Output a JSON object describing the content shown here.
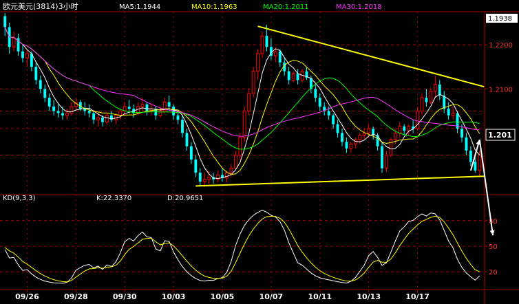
{
  "chart_data": {
    "type": "candlestick",
    "title": "欧元美元(3814)3小时",
    "ma_labels": [
      {
        "text": "MA5:1.1944",
        "color": "#ffffff"
      },
      {
        "text": "MA10:1.1963",
        "color": "#ffff00"
      },
      {
        "text": "MA20:1.2011",
        "color": "#00ff00"
      },
      {
        "text": "MA30:1.2018",
        "color": "#ff33ff"
      }
    ],
    "price_ylim": [
      1.1865,
      1.2275
    ],
    "price_ticks": [
      {
        "value": 1.22,
        "label": "1.2200"
      },
      {
        "value": 1.21,
        "label": "1.2100"
      }
    ],
    "top_price_label": "1.1938",
    "current_price_label": "1.201",
    "current_price": 1.201,
    "candles": [
      [
        1.2265,
        1.2272,
        1.222,
        1.224
      ],
      [
        1.224,
        1.225,
        1.218,
        1.2195
      ],
      [
        1.2195,
        1.223,
        1.2185,
        1.2215
      ],
      [
        1.2215,
        1.2225,
        1.2175,
        1.2185
      ],
      [
        1.2185,
        1.22,
        1.216,
        1.217
      ],
      [
        1.217,
        1.219,
        1.215,
        1.218
      ],
      [
        1.218,
        1.2185,
        1.214,
        1.215
      ],
      [
        1.215,
        1.216,
        1.211,
        1.212
      ],
      [
        1.212,
        1.213,
        1.209,
        1.21
      ],
      [
        1.21,
        1.211,
        1.207,
        1.208
      ],
      [
        1.208,
        1.209,
        1.205,
        1.206
      ],
      [
        1.206,
        1.2075,
        1.204,
        1.205
      ],
      [
        1.205,
        1.2065,
        1.2035,
        1.2045
      ],
      [
        1.2045,
        1.206,
        1.203,
        1.204
      ],
      [
        1.204,
        1.2055,
        1.203,
        1.2045
      ],
      [
        1.2045,
        1.207,
        1.204,
        1.206
      ],
      [
        1.206,
        1.208,
        1.205,
        1.207
      ],
      [
        1.207,
        1.2075,
        1.205,
        1.2055
      ],
      [
        1.2055,
        1.207,
        1.204,
        1.205
      ],
      [
        1.205,
        1.2065,
        1.2035,
        1.2045
      ],
      [
        1.2045,
        1.205,
        1.202,
        1.203
      ],
      [
        1.203,
        1.2045,
        1.2015,
        1.2035
      ],
      [
        1.2035,
        1.204,
        1.2015,
        1.2025
      ],
      [
        1.2025,
        1.2045,
        1.202,
        1.204
      ],
      [
        1.204,
        1.205,
        1.2025,
        1.203
      ],
      [
        1.203,
        1.2045,
        1.202,
        1.204
      ],
      [
        1.204,
        1.2055,
        1.203,
        1.205
      ],
      [
        1.205,
        1.207,
        1.204,
        1.206
      ],
      [
        1.206,
        1.2075,
        1.2045,
        1.2055
      ],
      [
        1.2055,
        1.2065,
        1.2035,
        1.2045
      ],
      [
        1.2045,
        1.207,
        1.204,
        1.206
      ],
      [
        1.206,
        1.208,
        1.205,
        1.2065
      ],
      [
        1.2065,
        1.207,
        1.204,
        1.205
      ],
      [
        1.205,
        1.2065,
        1.204,
        1.2055
      ],
      [
        1.2055,
        1.206,
        1.203,
        1.204
      ],
      [
        1.204,
        1.206,
        1.2035,
        1.205
      ],
      [
        1.205,
        1.208,
        1.2045,
        1.207
      ],
      [
        1.207,
        1.2085,
        1.205,
        1.206
      ],
      [
        1.206,
        1.2065,
        1.203,
        1.204
      ],
      [
        1.204,
        1.205,
        1.202,
        1.203
      ],
      [
        1.203,
        1.204,
        1.199,
        1.2
      ],
      [
        1.2,
        1.201,
        1.196,
        1.197
      ],
      [
        1.197,
        1.198,
        1.193,
        1.194
      ],
      [
        1.194,
        1.195,
        1.19,
        1.191
      ],
      [
        1.191,
        1.192,
        1.188,
        1.189
      ],
      [
        1.189,
        1.191,
        1.1878,
        1.1895
      ],
      [
        1.1895,
        1.1915,
        1.1885,
        1.19
      ],
      [
        1.19,
        1.191,
        1.1885,
        1.1895
      ],
      [
        1.1895,
        1.1915,
        1.1888,
        1.1905
      ],
      [
        1.1905,
        1.192,
        1.189,
        1.1898
      ],
      [
        1.1898,
        1.1915,
        1.1888,
        1.191
      ],
      [
        1.191,
        1.193,
        1.19,
        1.192
      ],
      [
        1.192,
        1.196,
        1.1915,
        1.195
      ],
      [
        1.195,
        1.2,
        1.194,
        1.199
      ],
      [
        1.199,
        1.206,
        1.198,
        1.205
      ],
      [
        1.205,
        1.21,
        1.204,
        1.209
      ],
      [
        1.209,
        1.215,
        1.208,
        1.214
      ],
      [
        1.214,
        1.219,
        1.212,
        1.218
      ],
      [
        1.218,
        1.223,
        1.217,
        1.222
      ],
      [
        1.222,
        1.2245,
        1.2185,
        1.2195
      ],
      [
        1.2195,
        1.2215,
        1.2165,
        1.2175
      ],
      [
        1.2175,
        1.2195,
        1.216,
        1.2185
      ],
      [
        1.2185,
        1.219,
        1.215,
        1.216
      ],
      [
        1.216,
        1.217,
        1.213,
        1.214
      ],
      [
        1.214,
        1.215,
        1.211,
        1.212
      ],
      [
        1.212,
        1.214,
        1.2115,
        1.2135
      ],
      [
        1.2135,
        1.2145,
        1.211,
        1.212
      ],
      [
        1.212,
        1.2145,
        1.2115,
        1.214
      ],
      [
        1.214,
        1.215,
        1.212,
        1.2125
      ],
      [
        1.2125,
        1.213,
        1.209,
        1.21
      ],
      [
        1.21,
        1.211,
        1.207,
        1.208
      ],
      [
        1.208,
        1.209,
        1.205,
        1.206
      ],
      [
        1.206,
        1.207,
        1.204,
        1.205
      ],
      [
        1.205,
        1.206,
        1.203,
        1.204
      ],
      [
        1.204,
        1.2045,
        1.201,
        1.202
      ],
      [
        1.202,
        1.203,
        1.199,
        1.2
      ],
      [
        1.2,
        1.201,
        1.197,
        1.198
      ],
      [
        1.198,
        1.199,
        1.1955,
        1.1965
      ],
      [
        1.1965,
        1.198,
        1.1955,
        1.1975
      ],
      [
        1.1975,
        1.199,
        1.1965,
        1.1985
      ],
      [
        1.1985,
        1.2,
        1.1975,
        1.1995
      ],
      [
        1.1995,
        1.201,
        1.1985,
        1.2
      ],
      [
        1.2,
        1.202,
        1.199,
        1.201
      ],
      [
        1.201,
        1.2015,
        1.1985,
        1.1995
      ],
      [
        1.1995,
        1.2,
        1.196,
        1.197
      ],
      [
        1.197,
        1.198,
        1.191,
        1.192
      ],
      [
        1.192,
        1.196,
        1.1912,
        1.195
      ],
      [
        1.195,
        1.199,
        1.1945,
        1.1985
      ],
      [
        1.1985,
        1.201,
        1.1975,
        1.2
      ],
      [
        1.2,
        1.2025,
        1.199,
        1.2015
      ],
      [
        1.2015,
        1.202,
        1.1995,
        1.2005
      ],
      [
        1.2005,
        1.202,
        1.1995,
        1.2015
      ],
      [
        1.2015,
        1.203,
        1.2,
        1.201
      ],
      [
        1.201,
        1.206,
        1.2005,
        1.205
      ],
      [
        1.205,
        1.209,
        1.204,
        1.208
      ],
      [
        1.208,
        1.21,
        1.206,
        1.207
      ],
      [
        1.207,
        1.21,
        1.2065,
        1.2095
      ],
      [
        1.2095,
        1.213,
        1.208,
        1.211
      ],
      [
        1.211,
        1.212,
        1.2075,
        1.2085
      ],
      [
        1.2085,
        1.2095,
        1.2045,
        1.2055
      ],
      [
        1.2055,
        1.207,
        1.203,
        1.204
      ],
      [
        1.204,
        1.206,
        1.203,
        1.2045
      ],
      [
        1.2045,
        1.205,
        1.2,
        1.201
      ],
      [
        1.201,
        1.202,
        1.198,
        1.199
      ],
      [
        1.199,
        1.2,
        1.195,
        1.196
      ],
      [
        1.196,
        1.197,
        1.1925,
        1.1935
      ],
      [
        1.1935,
        1.1945,
        1.191,
        1.1915
      ],
      [
        1.1915,
        1.196,
        1.19,
        1.195
      ]
    ],
    "ma_series": [
      {
        "period": 5,
        "color": "#ffffff"
      },
      {
        "period": 10,
        "color": "#ffff00"
      },
      {
        "period": 20,
        "color": "#00ff00"
      },
      {
        "period": 30,
        "color": "#ff33ff"
      }
    ],
    "trendlines": [
      {
        "color": "#ffff00",
        "points": [
          [
            57,
            1.2242
          ],
          [
            108,
            1.2105
          ]
        ]
      },
      {
        "color": "#ffff00",
        "points": [
          [
            43,
            1.188
          ],
          [
            108,
            1.1902
          ]
        ]
      }
    ],
    "up_arrow": {
      "from": [
        105,
        1.1915
      ],
      "to": [
        107,
        1.1985
      ]
    },
    "down_arrow": {
      "from": [
        107,
        1.1985
      ],
      "to": [
        110,
        1.1768
      ]
    },
    "kd_label": "KD(9,3,3)",
    "k_label": "K:22.3370",
    "d_label": "D:20.9651",
    "kd_ylim": [
      0,
      100
    ],
    "kd_ticks": [
      {
        "value": 80,
        "label": "80"
      },
      {
        "value": 50,
        "label": "50"
      },
      {
        "value": 20,
        "label": "20"
      }
    ],
    "x_tick_labels": [
      {
        "index": 5,
        "label": "09/26"
      },
      {
        "index": 16,
        "label": "09/28"
      },
      {
        "index": 27,
        "label": "09/30"
      },
      {
        "index": 38,
        "label": "10/03"
      },
      {
        "index": 49,
        "label": "10/05"
      },
      {
        "index": 60,
        "label": "10/07"
      },
      {
        "index": 71,
        "label": "10/11"
      },
      {
        "index": 82,
        "label": "10/13"
      },
      {
        "index": 93,
        "label": "10/17"
      }
    ],
    "colors": {
      "up": "#ff0000",
      "down": "#00ffff",
      "grid": "#aa0000",
      "axis": "#aa0000",
      "k_line": "#ffffff",
      "d_line": "#ffff00",
      "trendline": "#ffff00"
    }
  }
}
